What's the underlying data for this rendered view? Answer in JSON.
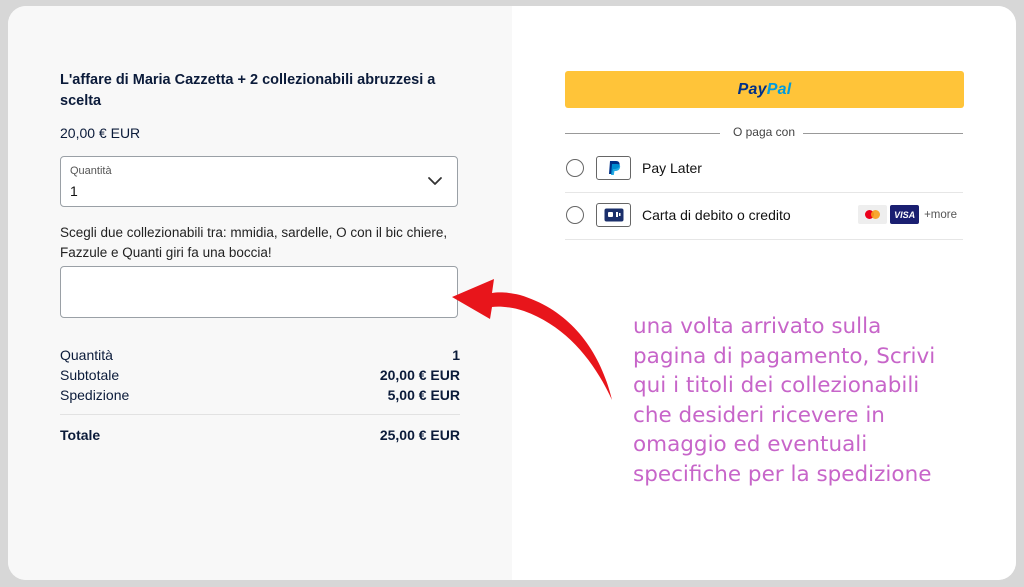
{
  "product": {
    "title": "L'affare di Maria Cazzetta + 2 collezionabili abruzzesi a scelta",
    "price": "20,00 € EUR"
  },
  "quantity_select": {
    "label": "Quantità",
    "value": "1"
  },
  "instructions": "Scegli due collezionabili tra: mmidia, sardelle, O con il bic chiere, Fazzule e Quanti giri fa una boccia!",
  "notes_input": {
    "value": ""
  },
  "summary": {
    "rows": [
      {
        "label": "Quantità",
        "value": "1"
      },
      {
        "label": "Subtotale",
        "value": "20,00 € EUR"
      },
      {
        "label": "Spedizione",
        "value": "5,00 € EUR"
      }
    ],
    "total": {
      "label": "Totale",
      "value": "25,00 € EUR"
    }
  },
  "paypal_button": {
    "part1": "Pay",
    "part2": "Pal"
  },
  "or_pay_with": "O paga con",
  "pay_options": {
    "pay_later": {
      "label": "Pay Later",
      "icon": "paypal-icon"
    },
    "card": {
      "label": "Carta di debito o credito",
      "icon": "card-icon",
      "brands": [
        "mastercard",
        "VISA"
      ],
      "more": "+more"
    }
  },
  "annotation": {
    "lines": [
      "una volta arrivato sulla",
      "pagina di pagamento, Scrivi",
      "qui i titoli dei collezionabili",
      "che desideri ricevere in",
      "omaggio ed eventuali",
      "specifiche per la spedizione"
    ],
    "color": "#c765c9",
    "arrow_color": "#e8151b"
  },
  "colors": {
    "paypal_yellow": "#ffc439",
    "paypal_dark_blue": "#003087",
    "paypal_light_blue": "#009cde",
    "text_navy": "#0b1b3a"
  }
}
